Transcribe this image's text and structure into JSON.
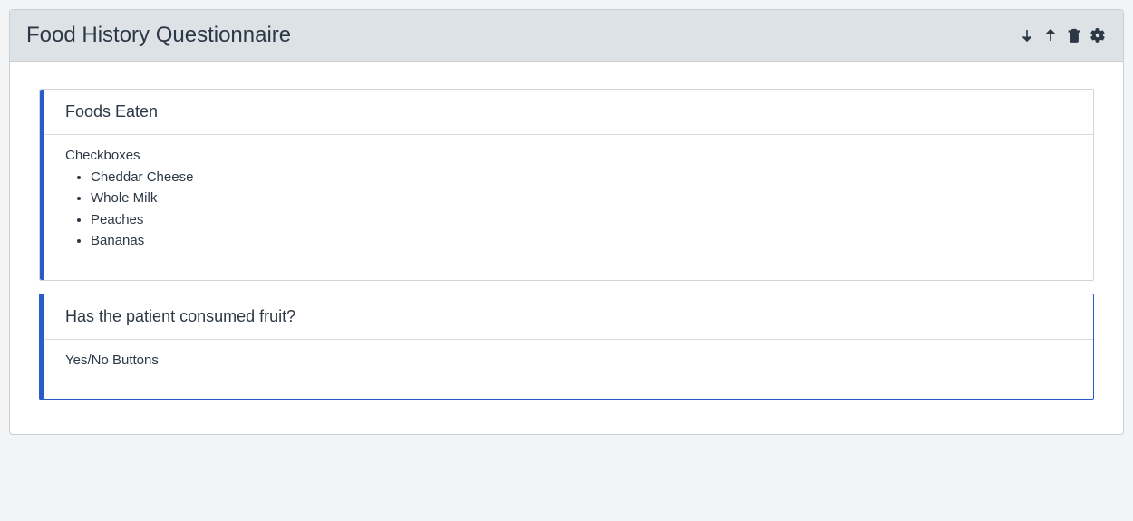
{
  "panel": {
    "title": "Food History Questionnaire"
  },
  "questions": [
    {
      "title": "Foods Eaten",
      "input_type": "Checkboxes",
      "items": [
        "Cheddar Cheese",
        "Whole Milk",
        "Peaches",
        "Bananas"
      ]
    },
    {
      "title": "Has the patient consumed fruit?",
      "input_type": "Yes/No Buttons"
    }
  ]
}
